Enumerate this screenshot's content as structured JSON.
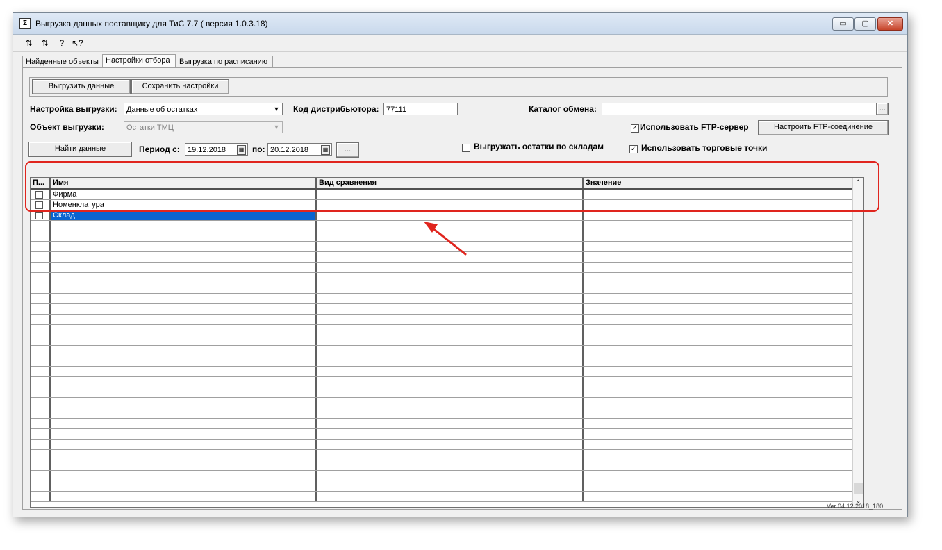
{
  "window": {
    "title": "Выгрузка данных поставщику для ТиС 7.7 ( версия 1.0.3.18)",
    "app_icon": "Σ",
    "min_glyph": "▭",
    "max_glyph": "▢",
    "close_glyph": "✕"
  },
  "toolbar": {
    "icons": [
      "connect-icon",
      "disconnect-icon",
      "help-icon",
      "context-help-icon"
    ],
    "glyphs": [
      "⇅",
      "⇅",
      "?",
      "↖?"
    ]
  },
  "tabs": [
    {
      "label": "Найденные объекты",
      "active": false
    },
    {
      "label": "Настройки отбора",
      "active": true
    },
    {
      "label": "Выгрузка по расписанию",
      "active": false
    }
  ],
  "actions": {
    "export_label": "Выгрузить данные",
    "save_label": "Сохранить настройки"
  },
  "form": {
    "setting_label": "Настройка выгрузки:",
    "setting_value": "Данные об остатках",
    "object_label": "Объект выгрузки:",
    "object_value": "Остатки ТМЦ",
    "distributor_label": "Код дистрибьютора:",
    "distributor_value": "77111",
    "catalog_label": "Каталог обмена:",
    "catalog_value": "",
    "browse_label": "...",
    "use_ftp_label": "Использовать FTP-сервер",
    "use_ftp_checked": true,
    "ftp_button_label": "Настроить FTP-соединение",
    "find_label": "Найти данные",
    "period_from_label": "Период с:",
    "period_from_value": "19.12.2018",
    "period_to_label": "по:",
    "period_to_value": "20.12.2018",
    "period_more_label": "...",
    "by_warehouse_label": "Выгружать остатки по складам",
    "by_warehouse_checked": false,
    "trade_points_label": "Использовать торговые точки",
    "trade_points_checked": true,
    "check_glyph": "✓",
    "dropdown_glyph": "▼",
    "calendar_glyph": "▦"
  },
  "grid": {
    "columns": [
      "П...",
      "Имя",
      "Вид сравнения",
      "Значение"
    ],
    "rows": [
      {
        "name": "Фирма",
        "compare": "",
        "value": "",
        "selected": false
      },
      {
        "name": "Номенклатура",
        "compare": "",
        "value": "",
        "selected": false
      },
      {
        "name": "Склад",
        "compare": "",
        "value": "",
        "selected": true
      }
    ],
    "scroll_up": "⌃",
    "scroll_down": "⌄"
  },
  "footer": {
    "version": "Ver 04.12.2018_180"
  },
  "colors": {
    "selection": "#0a64d0",
    "highlight": "#e0251e"
  }
}
